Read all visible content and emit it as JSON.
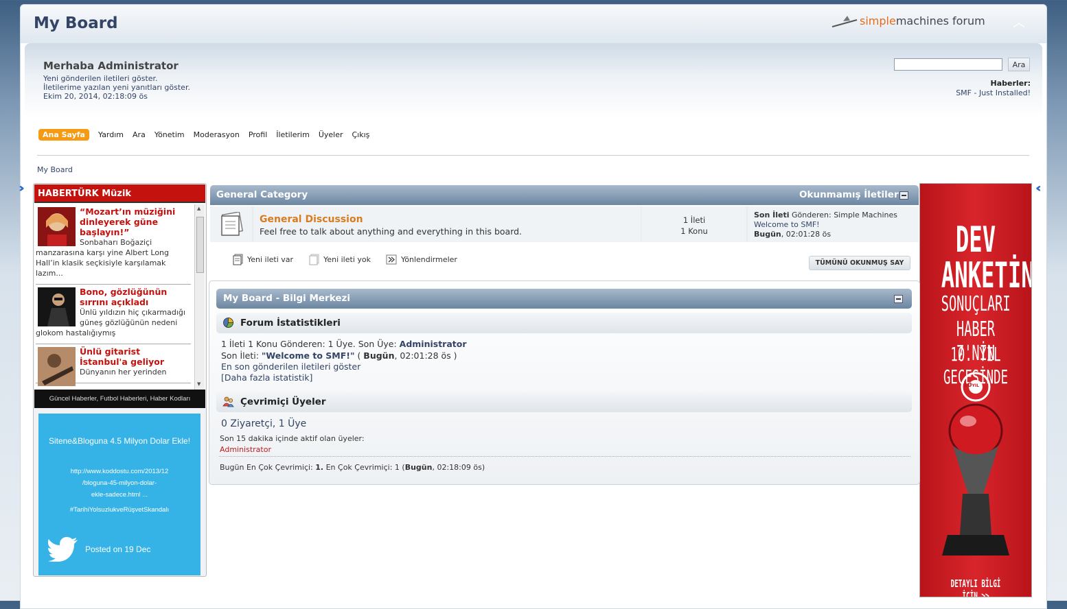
{
  "header": {
    "forum_title": "My Board",
    "logo_simple": "simple",
    "logo_machines": "machines",
    "logo_forum": " forum"
  },
  "user": {
    "greeting": "Merhaba Administrator",
    "links": [
      "Yeni gönderilen iletileri göster.",
      "İletilerime yazılan yeni yanıtları göster.",
      "Ekim 20, 2014, 02:18:09 ös"
    ]
  },
  "search": {
    "button_label": "Ara",
    "value": ""
  },
  "news": {
    "label": "Haberler:",
    "text": "SMF - Just Installed!"
  },
  "menu": [
    "Ana Sayfa",
    "Yardım",
    "Ara",
    "Yönetim",
    "Moderasyon",
    "Profil",
    "İletilerim",
    "Üyeler",
    "Çıkış"
  ],
  "breadcrumb": "My Board",
  "habertürk": {
    "title": "HABERTÜRK Müzik",
    "items": [
      {
        "title": "“Mozart’ın müziğini dinleyerek güne başlayın!”",
        "text": "Sonbaharı Boğaziçi manzarasına karşı yine Albert Long Hall’in klasik seçkisiyle karşılamak lazım..."
      },
      {
        "title": "Bono, gözlüğünün sırrını açıkladı",
        "text": "Ünlü yıldızın hiç çıkarmadığı güneş gözlüğünün nedeni glokom hastalığıymış"
      },
      {
        "title": "Ünlü gitarist İstanbul'a geliyor",
        "text": "Dünyanın her yerinden"
      }
    ],
    "footer": "Güncel Haberler, Futbol Haberleri, Haber Kodları"
  },
  "twitter": {
    "title": "Sitene&Bloguna 4.5 Milyon Dolar Ekle!",
    "url_lines": [
      "http://www.koddostu.com/2013/12",
      "/bloguna-45-milyon-dolar-",
      "ekle-sadece.html ..."
    ],
    "hashtag": "#TarihiYolsuzlukveRüşvetSkandalı",
    "posted": "Posted on 19 Dec"
  },
  "ad": {
    "line1": "DEV",
    "line2": "ANKETİN",
    "line3": "SONUÇLARI",
    "line4": "HABER 7'NİN",
    "line5": "10. YIL GECESİNDE",
    "badge": "10",
    "badge_small": "YIL",
    "cta": "DETAYLI BİLGİ İÇİN >>"
  },
  "category": {
    "title": "General Category",
    "unread_label": "Okunmamış İletiler",
    "board": {
      "name": "General Discussion",
      "description": "Feel free to talk about anything and everything in this board.",
      "posts": "1 İleti",
      "topics": "1 Konu",
      "last_label": "Son İleti",
      "last_by": " Gönderen: Simple Machines",
      "last_topic": "Welcome to SMF!",
      "last_day": "Bugün",
      "last_time": ", 02:01:28 ös"
    }
  },
  "legend": [
    "Yeni ileti var",
    "Yeni ileti yok",
    "Yönlendirmeler"
  ],
  "mark_all_read": "TÜMÜNÜ OKUNMUŞ SAY",
  "info_center": {
    "title": "My Board - Bilgi Merkezi",
    "stats_title": "Forum İstatistikleri",
    "stats_line1_prefix": "1 İleti 1 Konu Gönderen: 1 Üye. Son Üye: ",
    "stats_line1_member": "Administrator",
    "stats_line2_prefix": "Son İleti: ",
    "stats_line2_topic": "\"Welcome to SMF!\"",
    "stats_line2_open": " ( ",
    "stats_line2_day": "Bugün",
    "stats_line2_time": ", 02:01:28 ös )",
    "stats_recent_link": "En son gönderilen iletileri göster",
    "stats_more_link": "[Daha fazla istatistik]",
    "online_title": "Çevrimiçi Üyeler",
    "online_count": "0 Ziyaretçi, 1 Üye",
    "online_recent": "Son 15 dakika içinde aktif olan üyeler:",
    "online_member": "Administrator",
    "most_online_prefix": "Bugün En Çok Çevrimiçi: ",
    "most_online_today": "1.",
    "most_online_mid": " En Çok Çevrimiçi: 1 (",
    "most_online_day": "Bugün",
    "most_online_end": ", 02:18:09 ös)"
  },
  "colors": {
    "menu_active": "#f59a12",
    "header_blue": "#6c86a1",
    "board_orange": "#d97b1f",
    "habertürk_red": "#c4120e",
    "twitter_blue": "#35b2e6",
    "ad_red": "#d8252b"
  }
}
